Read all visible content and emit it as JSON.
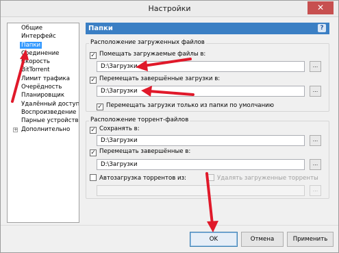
{
  "window": {
    "title": "Настройки"
  },
  "tree": [
    {
      "label": "Общие"
    },
    {
      "label": "Интерфейс"
    },
    {
      "label": "Папки",
      "selected": true
    },
    {
      "label": "Соединение"
    },
    {
      "label": "Скорость"
    },
    {
      "label": "BitTorrent"
    },
    {
      "label": "Лимит трафика"
    },
    {
      "label": "Очерёдность"
    },
    {
      "label": "Планировщик"
    },
    {
      "label": "Удалённый доступ"
    },
    {
      "label": "Воспроизведение"
    },
    {
      "label": "Парные устройства"
    },
    {
      "label": "Дополнительно",
      "expandable": true
    }
  ],
  "panel": {
    "header": "Папки",
    "help_icon": "?",
    "downloaded": {
      "legend": "Расположение загруженных файлов",
      "place_label": "Помещать загружаемые файлы в:",
      "place_checked": true,
      "place_path": "D:\\Загрузки",
      "move_label": "Перемещать завершённые загрузки в:",
      "move_checked": true,
      "move_path": "D:\\Загрузки",
      "only_default_label": "Перемещать загрузки только из папки по умолчанию",
      "only_default_checked": true
    },
    "torrents": {
      "legend": "Расположение торрент-файлов",
      "save_label": "Сохранять в:",
      "save_checked": true,
      "save_path": "D:\\Загрузки",
      "move_label": "Перемещать завершённые в:",
      "move_checked": true,
      "move_path": "D:\\Загрузки",
      "autoload_label": "Автозагрузка торрентов из:",
      "autoload_checked": false,
      "delete_loaded_label": "Удалять загруженные торренты",
      "delete_loaded_checked": false,
      "autoload_path": ""
    },
    "browse_label": "...",
    "check_mark": "✓"
  },
  "buttons": {
    "ok": "OK",
    "cancel": "Отмена",
    "apply": "Применить"
  },
  "close_icon": "✕",
  "tree_expander": "+",
  "colors": {
    "header_bg": "#3b7fc4",
    "selection": "#3399ff",
    "annotation_arrow": "#e0192a"
  }
}
